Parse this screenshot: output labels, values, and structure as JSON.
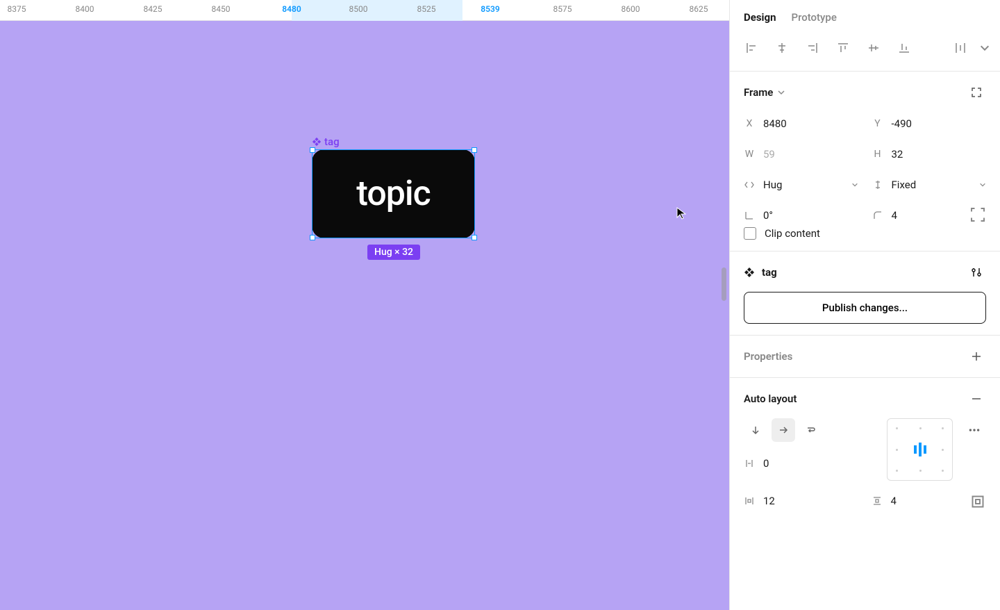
{
  "ruler": {
    "ticks": [
      {
        "v": "8375",
        "pos": 24,
        "sel": false
      },
      {
        "v": "8400",
        "pos": 122,
        "sel": false
      },
      {
        "v": "8425",
        "pos": 220,
        "sel": false
      },
      {
        "v": "8450",
        "pos": 318,
        "sel": false
      },
      {
        "v": "8480",
        "pos": 420,
        "sel": true
      },
      {
        "v": "8500",
        "pos": 516,
        "sel": false
      },
      {
        "v": "8525",
        "pos": 614,
        "sel": false
      },
      {
        "v": "8539",
        "pos": 706,
        "sel": true
      },
      {
        "v": "8575",
        "pos": 810,
        "sel": false
      },
      {
        "v": "8600",
        "pos": 908,
        "sel": false
      },
      {
        "v": "8625",
        "pos": 1006,
        "sel": false
      }
    ],
    "sel_start": 420,
    "sel_end": 666
  },
  "canvas": {
    "node_label": "tag",
    "node_text": "topic",
    "dim_badge": "Hug × 32"
  },
  "panel": {
    "tabs": {
      "design": "Design",
      "prototype": "Prototype"
    },
    "frame": {
      "title": "Frame",
      "x_label": "X",
      "x": "8480",
      "y_label": "Y",
      "y": "-490",
      "w_label": "W",
      "w": "59",
      "h_label": "H",
      "h": "32",
      "horiz": "Hug",
      "vert": "Fixed",
      "rot": "0°",
      "radius": "4",
      "clip": "Clip content"
    },
    "component": {
      "name": "tag",
      "publish": "Publish changes..."
    },
    "properties": {
      "title": "Properties"
    },
    "autolayout": {
      "title": "Auto layout",
      "gap": "0",
      "pad_h": "12",
      "pad_v": "4"
    }
  }
}
